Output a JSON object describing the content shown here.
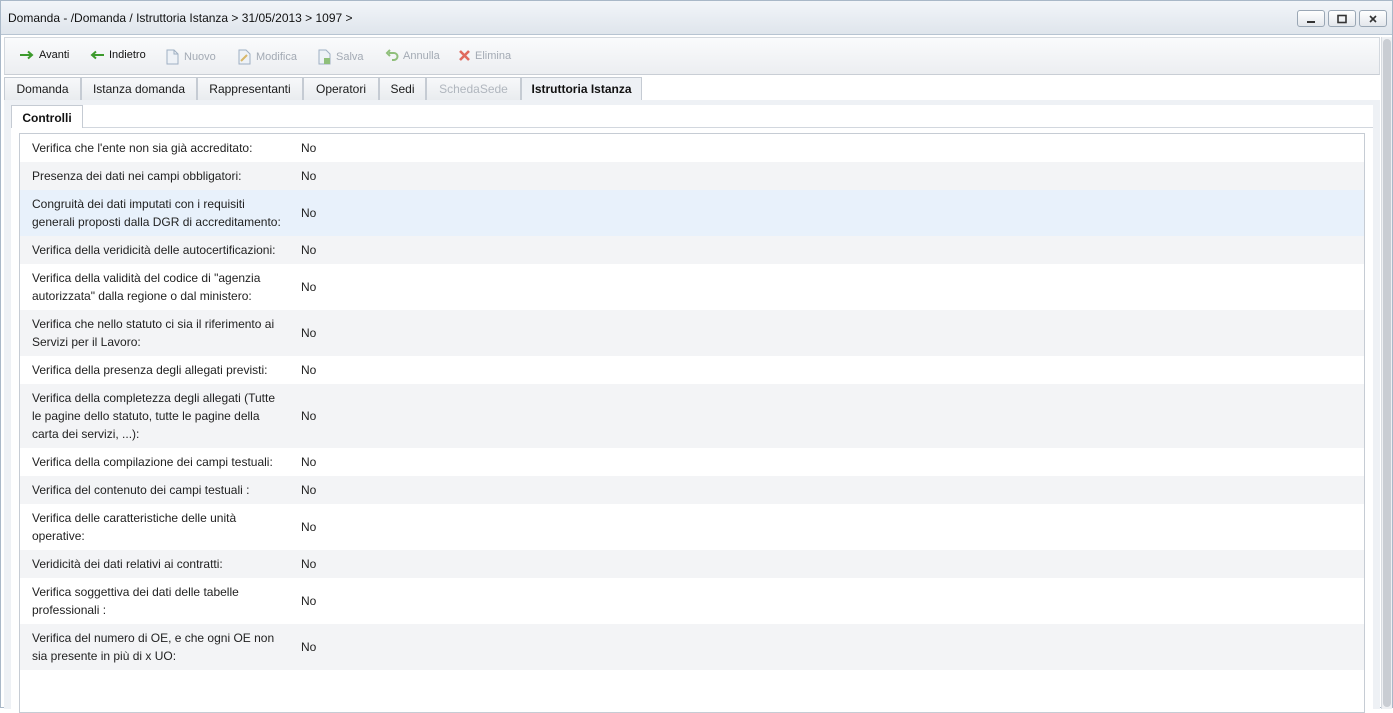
{
  "window": {
    "title": "Domanda - /Domanda / Istruttoria Istanza > 31/05/2013 > 1097 >"
  },
  "toolbar": {
    "items": [
      {
        "label": "Avanti",
        "icon": "arrow-right-icon",
        "enabled": true
      },
      {
        "label": "Indietro",
        "icon": "arrow-left-icon",
        "enabled": true
      },
      {
        "label": "Nuovo",
        "icon": "new-document-icon",
        "enabled": false
      },
      {
        "label": "Modifica",
        "icon": "edit-document-icon",
        "enabled": false
      },
      {
        "label": "Salva",
        "icon": "save-document-icon",
        "enabled": false
      },
      {
        "label": "Annulla",
        "icon": "undo-icon",
        "enabled": false
      },
      {
        "label": "Elimina",
        "icon": "delete-x-icon",
        "enabled": false
      }
    ]
  },
  "tabs": [
    {
      "label": "Domanda",
      "state": "normal"
    },
    {
      "label": "Istanza domanda",
      "state": "normal"
    },
    {
      "label": "Rappresentanti",
      "state": "normal"
    },
    {
      "label": "Operatori",
      "state": "normal"
    },
    {
      "label": "Sedi",
      "state": "normal"
    },
    {
      "label": "SchedaSede",
      "state": "disabled"
    },
    {
      "label": "Istruttoria Istanza",
      "state": "active"
    }
  ],
  "subtab": {
    "label": "Controlli"
  },
  "controls": [
    {
      "label": "Verifica che l'ente non sia già accreditato:",
      "value": "No"
    },
    {
      "label": "Presenza dei dati nei campi obbligatori:",
      "value": "No"
    },
    {
      "label": "Congruità dei dati imputati con i requisiti generali proposti dalla DGR di accreditamento:",
      "value": "No"
    },
    {
      "label": "Verifica della veridicità delle autocertificazioni:",
      "value": "No"
    },
    {
      "label": "Verifica della validità del codice di \"agenzia autorizzata\" dalla regione o dal ministero:",
      "value": "No"
    },
    {
      "label": "Verifica che nello statuto ci sia il riferimento ai Servizi per il Lavoro:",
      "value": "No"
    },
    {
      "label": "Verifica della presenza degli allegati previsti:",
      "value": "No"
    },
    {
      "label": "Verifica della completezza degli allegati (Tutte le pagine dello statuto, tutte le pagine della carta dei servizi, ...):",
      "value": "No"
    },
    {
      "label": "Verifica della compilazione dei campi testuali:",
      "value": "No"
    },
    {
      "label": "Verifica del contenuto dei campi testuali :",
      "value": "No"
    },
    {
      "label": "Verifica delle caratteristiche delle unità operative:",
      "value": "No"
    },
    {
      "label": "Veridicità dei dati relativi ai contratti:",
      "value": "No"
    },
    {
      "label": "Verifica soggettiva dei dati delle tabelle professionali :",
      "value": "No"
    },
    {
      "label": "Verifica del numero di OE, e che ogni OE non sia presente in più di x UO:",
      "value": "No"
    }
  ]
}
